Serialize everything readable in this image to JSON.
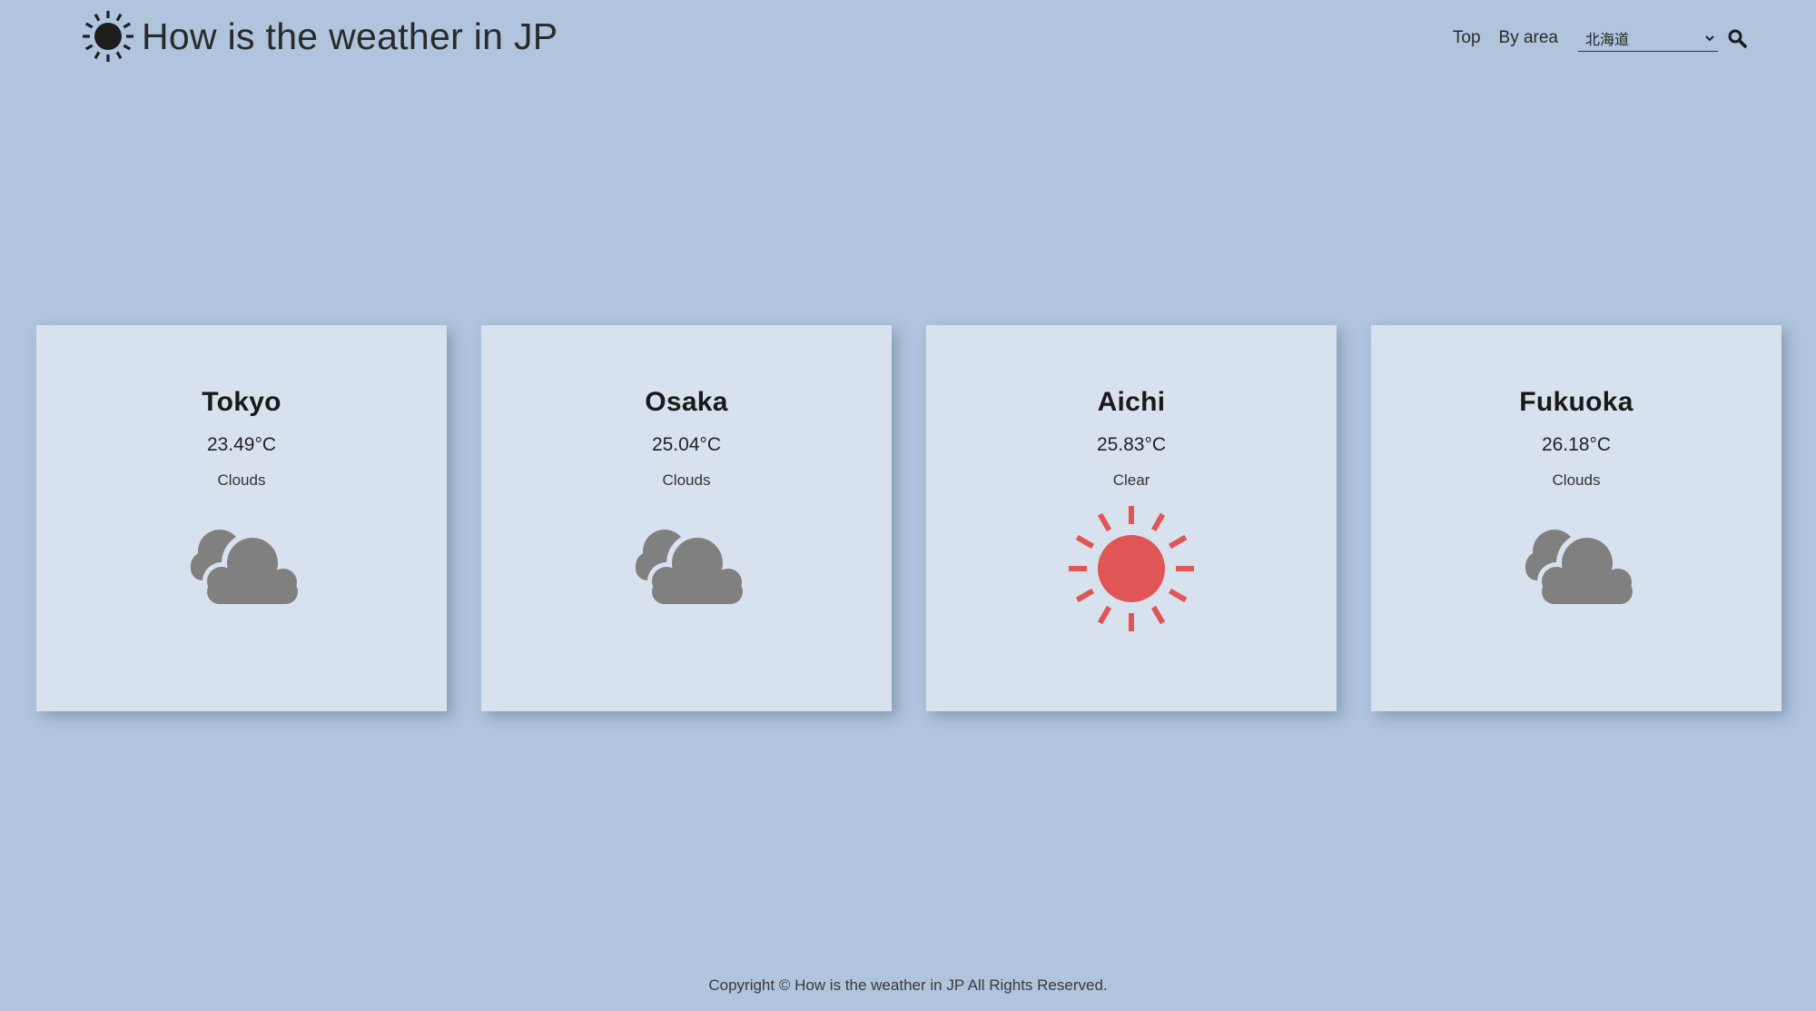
{
  "header": {
    "logo_icon": "sun-icon",
    "title": "How is the weather in JP"
  },
  "nav": {
    "top_label": "Top",
    "by_area_label": "By area",
    "area_select": {
      "value": "北海道",
      "icon": "chevron-down-icon"
    },
    "search_icon": "search-icon"
  },
  "cards": [
    {
      "city": "Tokyo",
      "temp": "23.49°C",
      "condition": "Clouds",
      "icon": "clouds-icon"
    },
    {
      "city": "Osaka",
      "temp": "25.04°C",
      "condition": "Clouds",
      "icon": "clouds-icon"
    },
    {
      "city": "Aichi",
      "temp": "25.83°C",
      "condition": "Clear",
      "icon": "sun-icon"
    },
    {
      "city": "Fukuoka",
      "temp": "26.18°C",
      "condition": "Clouds",
      "icon": "clouds-icon"
    }
  ],
  "colors": {
    "background": "#b0c4de",
    "card": "#d8e2ee",
    "cloud": "#808080",
    "sun": "#e05555"
  },
  "footer": {
    "copyright": "Copyright © How is the weather in JP All Rights Reserved."
  }
}
